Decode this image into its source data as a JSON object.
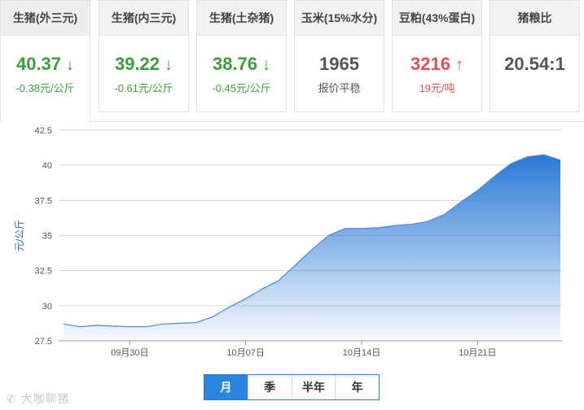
{
  "cards": [
    {
      "title": "生猪(外三元)",
      "value": "40.37",
      "arrow": "↓",
      "sub": "-0.38元/公斤",
      "color": "#3a9f3a",
      "active": true
    },
    {
      "title": "生猪(内三元)",
      "value": "39.22",
      "arrow": "↓",
      "sub": "-0.61元/公斤",
      "color": "#3a9f3a"
    },
    {
      "title": "生猪(土杂猪)",
      "value": "38.76",
      "arrow": "↓",
      "sub": "-0.45元/公斤",
      "color": "#3a9f3a"
    },
    {
      "title": "玉米(15%水分)",
      "value": "1965",
      "arrow": "",
      "sub": "报价平稳",
      "color": "#555555"
    },
    {
      "title": "豆粕(43%蛋白)",
      "value": "3216",
      "arrow": "↑",
      "sub": "19元/吨",
      "color": "#e2504e"
    },
    {
      "title": "猪粮比",
      "value": "20.54:1",
      "arrow": "",
      "sub": "",
      "color": "#555555"
    }
  ],
  "tabs": [
    "月",
    "季",
    "半年",
    "年"
  ],
  "active_tab": "月",
  "watermark": "大咖聊猪",
  "chart_data": {
    "type": "area",
    "title": "",
    "xlabel": "",
    "ylabel": "元/公斤",
    "ylim": [
      27.5,
      42.5
    ],
    "yticks": [
      "27.5",
      "30",
      "32.5",
      "35",
      "37.5",
      "40",
      "42.5"
    ],
    "xticks": [
      {
        "label": "09月30日",
        "x": "09-30"
      },
      {
        "label": "10月07日",
        "x": "10-07"
      },
      {
        "label": "10月14日",
        "x": "10-14"
      },
      {
        "label": "10月21日",
        "x": "10-21"
      }
    ],
    "grid": true,
    "color": "#2a7ad6",
    "x": [
      "09-26",
      "09-27",
      "09-28",
      "09-29",
      "09-30",
      "10-01",
      "10-02",
      "10-03",
      "10-04",
      "10-05",
      "10-06",
      "10-07",
      "10-08",
      "10-09",
      "10-10",
      "10-11",
      "10-12",
      "10-13",
      "10-14",
      "10-15",
      "10-16",
      "10-17",
      "10-18",
      "10-19",
      "10-20",
      "10-21",
      "10-22",
      "10-23",
      "10-24",
      "10-25",
      "10-26"
    ],
    "values": [
      28.7,
      28.5,
      28.6,
      28.55,
      28.5,
      28.5,
      28.7,
      28.75,
      28.8,
      29.2,
      29.9,
      30.5,
      31.2,
      31.8,
      32.9,
      34.0,
      35.0,
      35.5,
      35.5,
      35.55,
      35.7,
      35.8,
      36.0,
      36.5,
      37.4,
      38.2,
      39.2,
      40.1,
      40.6,
      40.75,
      40.37
    ]
  }
}
